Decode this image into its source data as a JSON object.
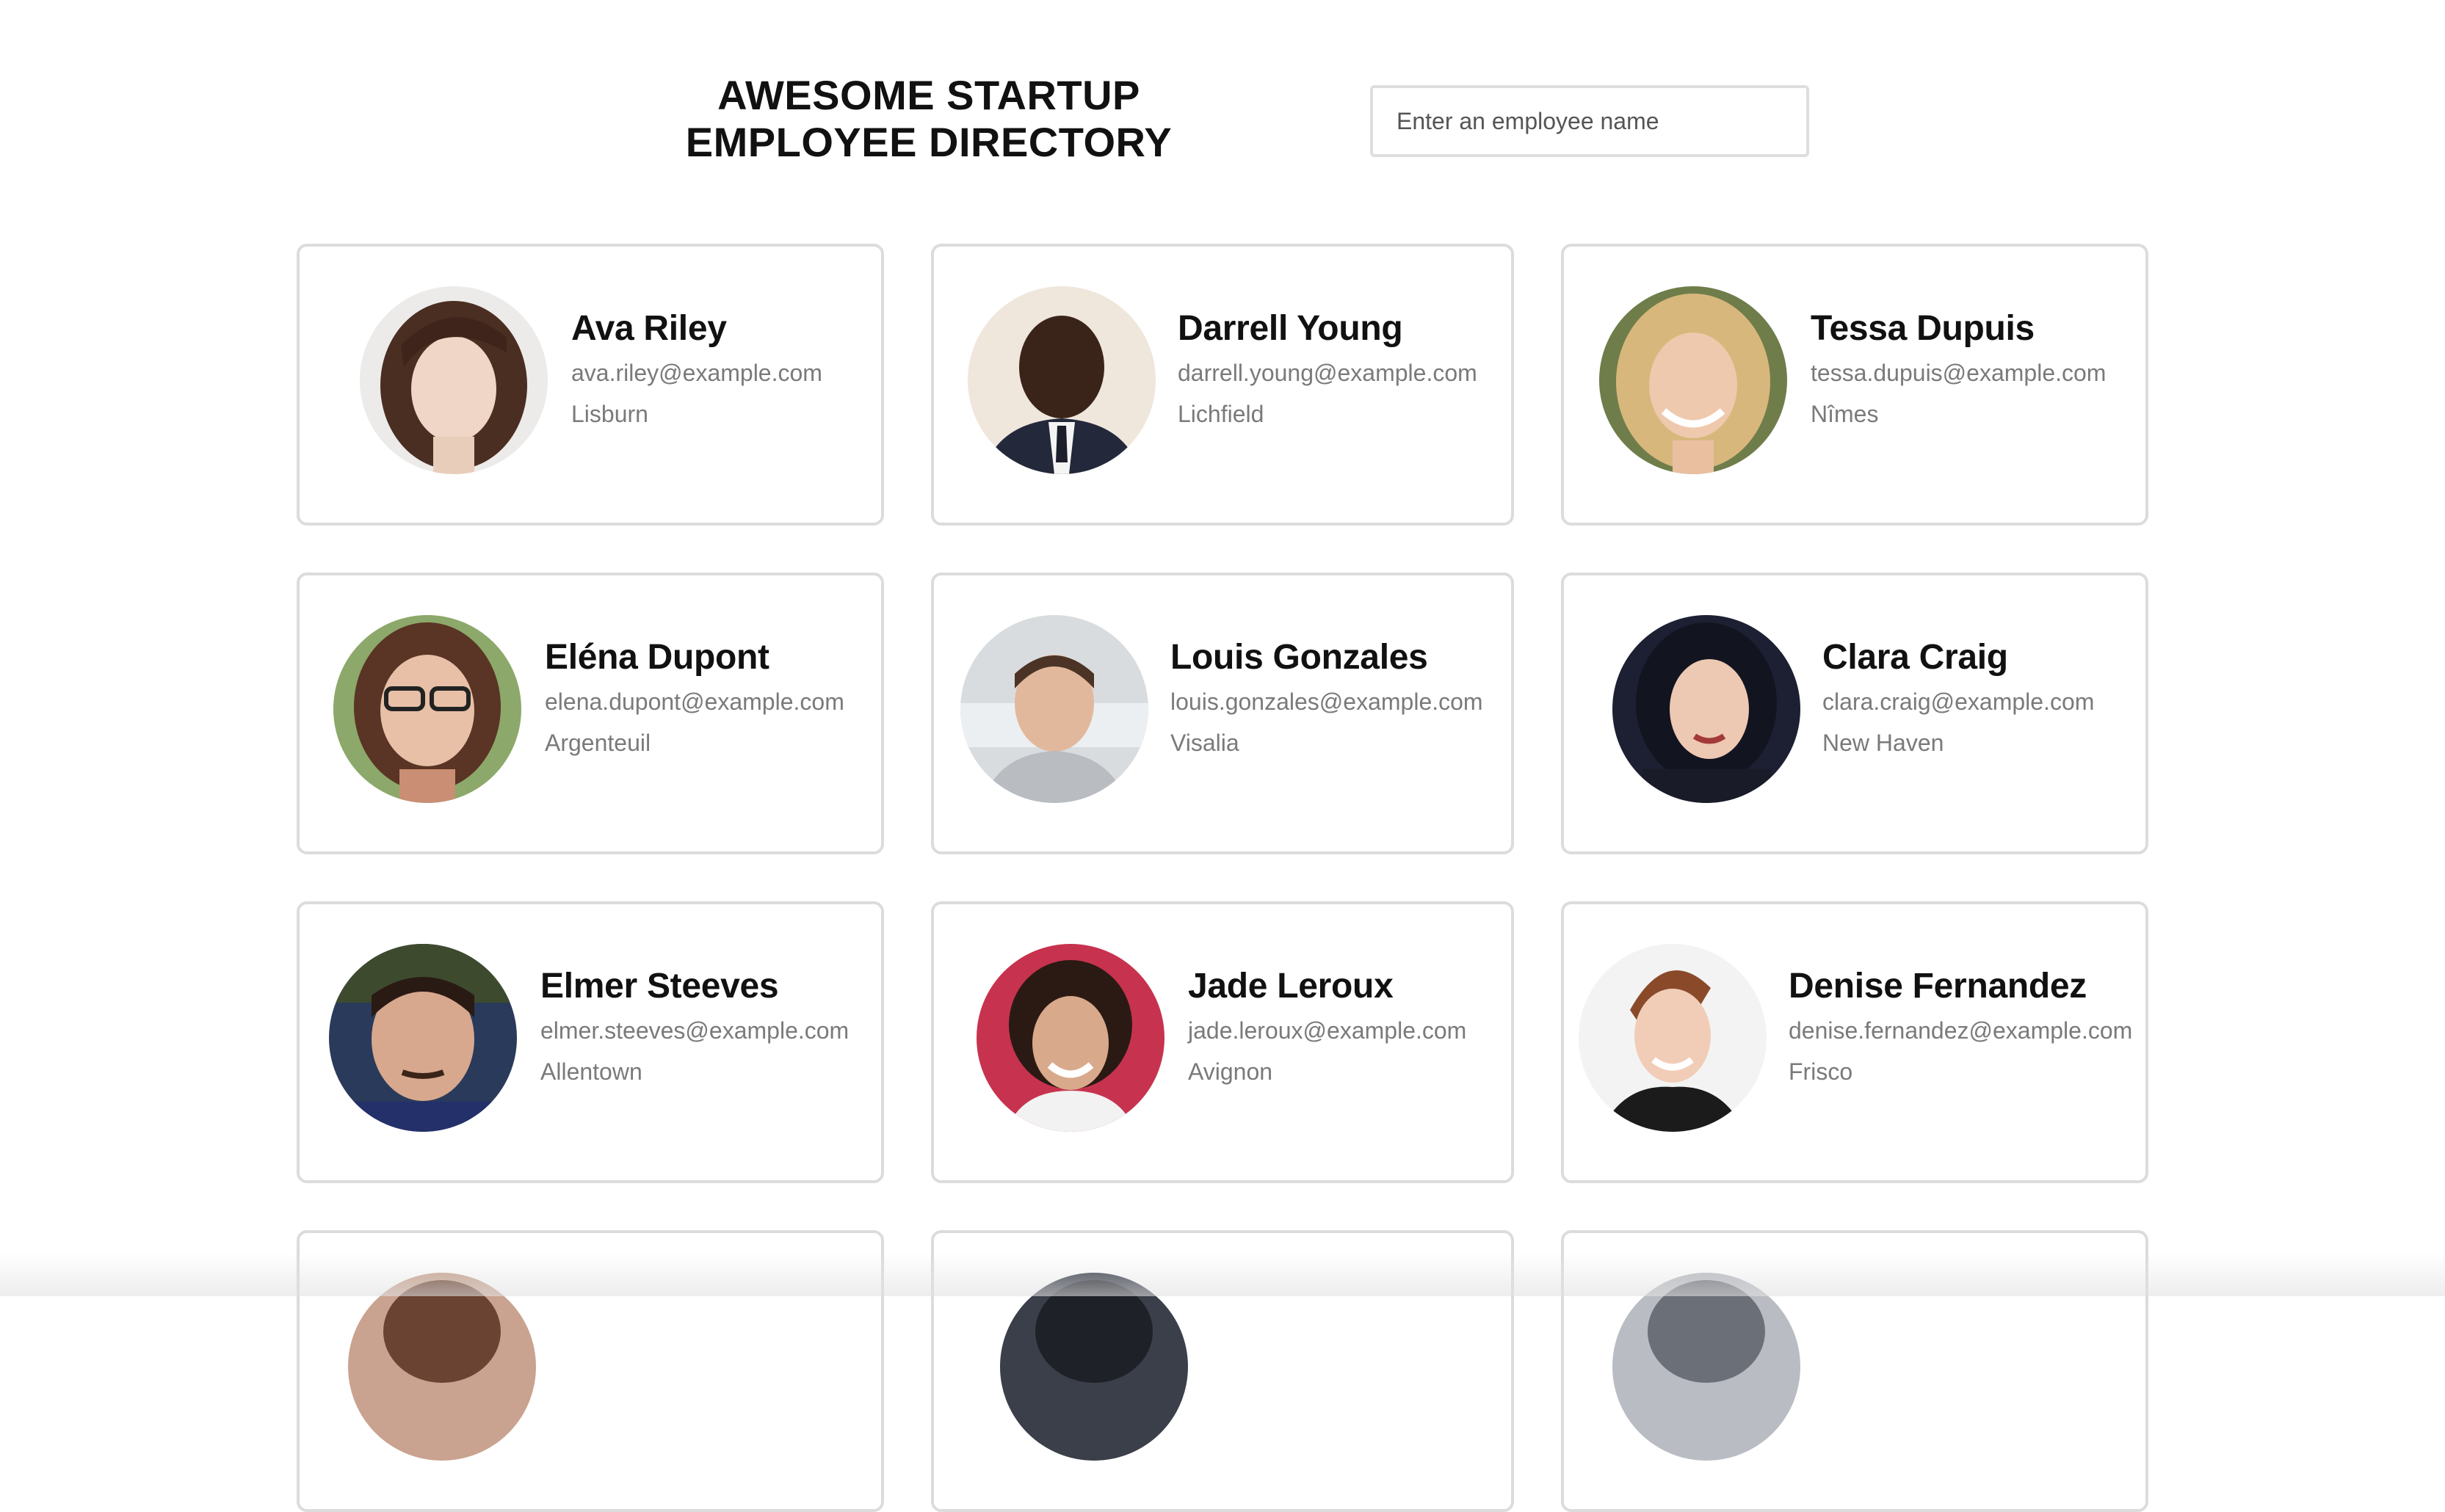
{
  "header": {
    "title_line1": "AWESOME STARTUP",
    "title_line2": "EMPLOYEE DIRECTORY",
    "search_placeholder": "Enter an employee name"
  },
  "employees": [
    {
      "name": "Ava Riley",
      "email": "ava.riley@example.com",
      "city": "Lisburn"
    },
    {
      "name": "Darrell Young",
      "email": "darrell.young@example.com",
      "city": "Lichfield"
    },
    {
      "name": "Tessa Dupuis",
      "email": "tessa.dupuis@example.com",
      "city": "Nîmes"
    },
    {
      "name": "Eléna Dupont",
      "email": "elena.dupont@example.com",
      "city": "Argenteuil"
    },
    {
      "name": "Louis Gonzales",
      "email": "louis.gonzales@example.com",
      "city": "Visalia"
    },
    {
      "name": "Clara Craig",
      "email": "clara.craig@example.com",
      "city": "New Haven"
    },
    {
      "name": "Elmer Steeves",
      "email": "elmer.steeves@example.com",
      "city": "Allentown"
    },
    {
      "name": "Jade Leroux",
      "email": "jade.leroux@example.com",
      "city": "Avignon"
    },
    {
      "name": "Denise Fernandez",
      "email": "denise.fernandez@example.com",
      "city": "Frisco"
    }
  ]
}
